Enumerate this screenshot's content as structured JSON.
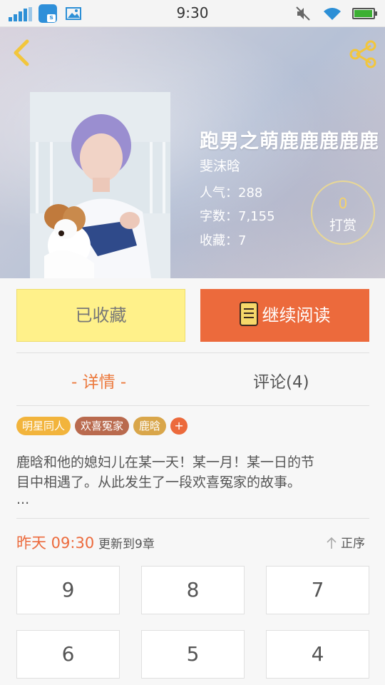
{
  "status_bar": {
    "time": "9:30",
    "icons": [
      "signal-icon",
      "app-s-icon",
      "gallery-icon",
      "mute-icon",
      "wifi-icon",
      "battery-icon"
    ],
    "app_badge": "s",
    "battery_level": 0.85
  },
  "header": {
    "back_icon": "chevron-left-icon",
    "share_icon": "share-icon",
    "accent_color": "#f2c63c"
  },
  "book": {
    "title": "跑男之萌鹿鹿鹿鹿鹿",
    "author": "斐沫晗",
    "popularity_label": "人气：",
    "popularity": "288",
    "words_label": "字数：",
    "words": "7,155",
    "favorites_label": "收藏：",
    "favorites": "7",
    "reward_count": "0",
    "reward_label": "打赏"
  },
  "actions": {
    "collected_label": "已收藏",
    "read_label": "继续阅读",
    "read_color": "#ec6a3c",
    "collected_color": "#fff18a"
  },
  "tabs": {
    "detail_label": "- 详情 -",
    "comments_label": "评论(4)"
  },
  "tags": [
    {
      "label": "明星同人",
      "color": "#f2b43c"
    },
    {
      "label": "欢喜冤家",
      "color": "#b96a4e"
    },
    {
      "label": "鹿晗",
      "color": "#d9a64a"
    }
  ],
  "tag_add": "+",
  "description": {
    "line1": "鹿晗和他的媳妇儿在某一天！某一月！某一日的节",
    "line2": "目中相遇了。从此发生了一段欢喜冤家的故事。",
    "line3": "..."
  },
  "update": {
    "time": "昨天 09:30",
    "text": "更新到9章",
    "sort_label": "正序"
  },
  "chapters": [
    "9",
    "8",
    "7",
    "6",
    "5",
    "4"
  ]
}
